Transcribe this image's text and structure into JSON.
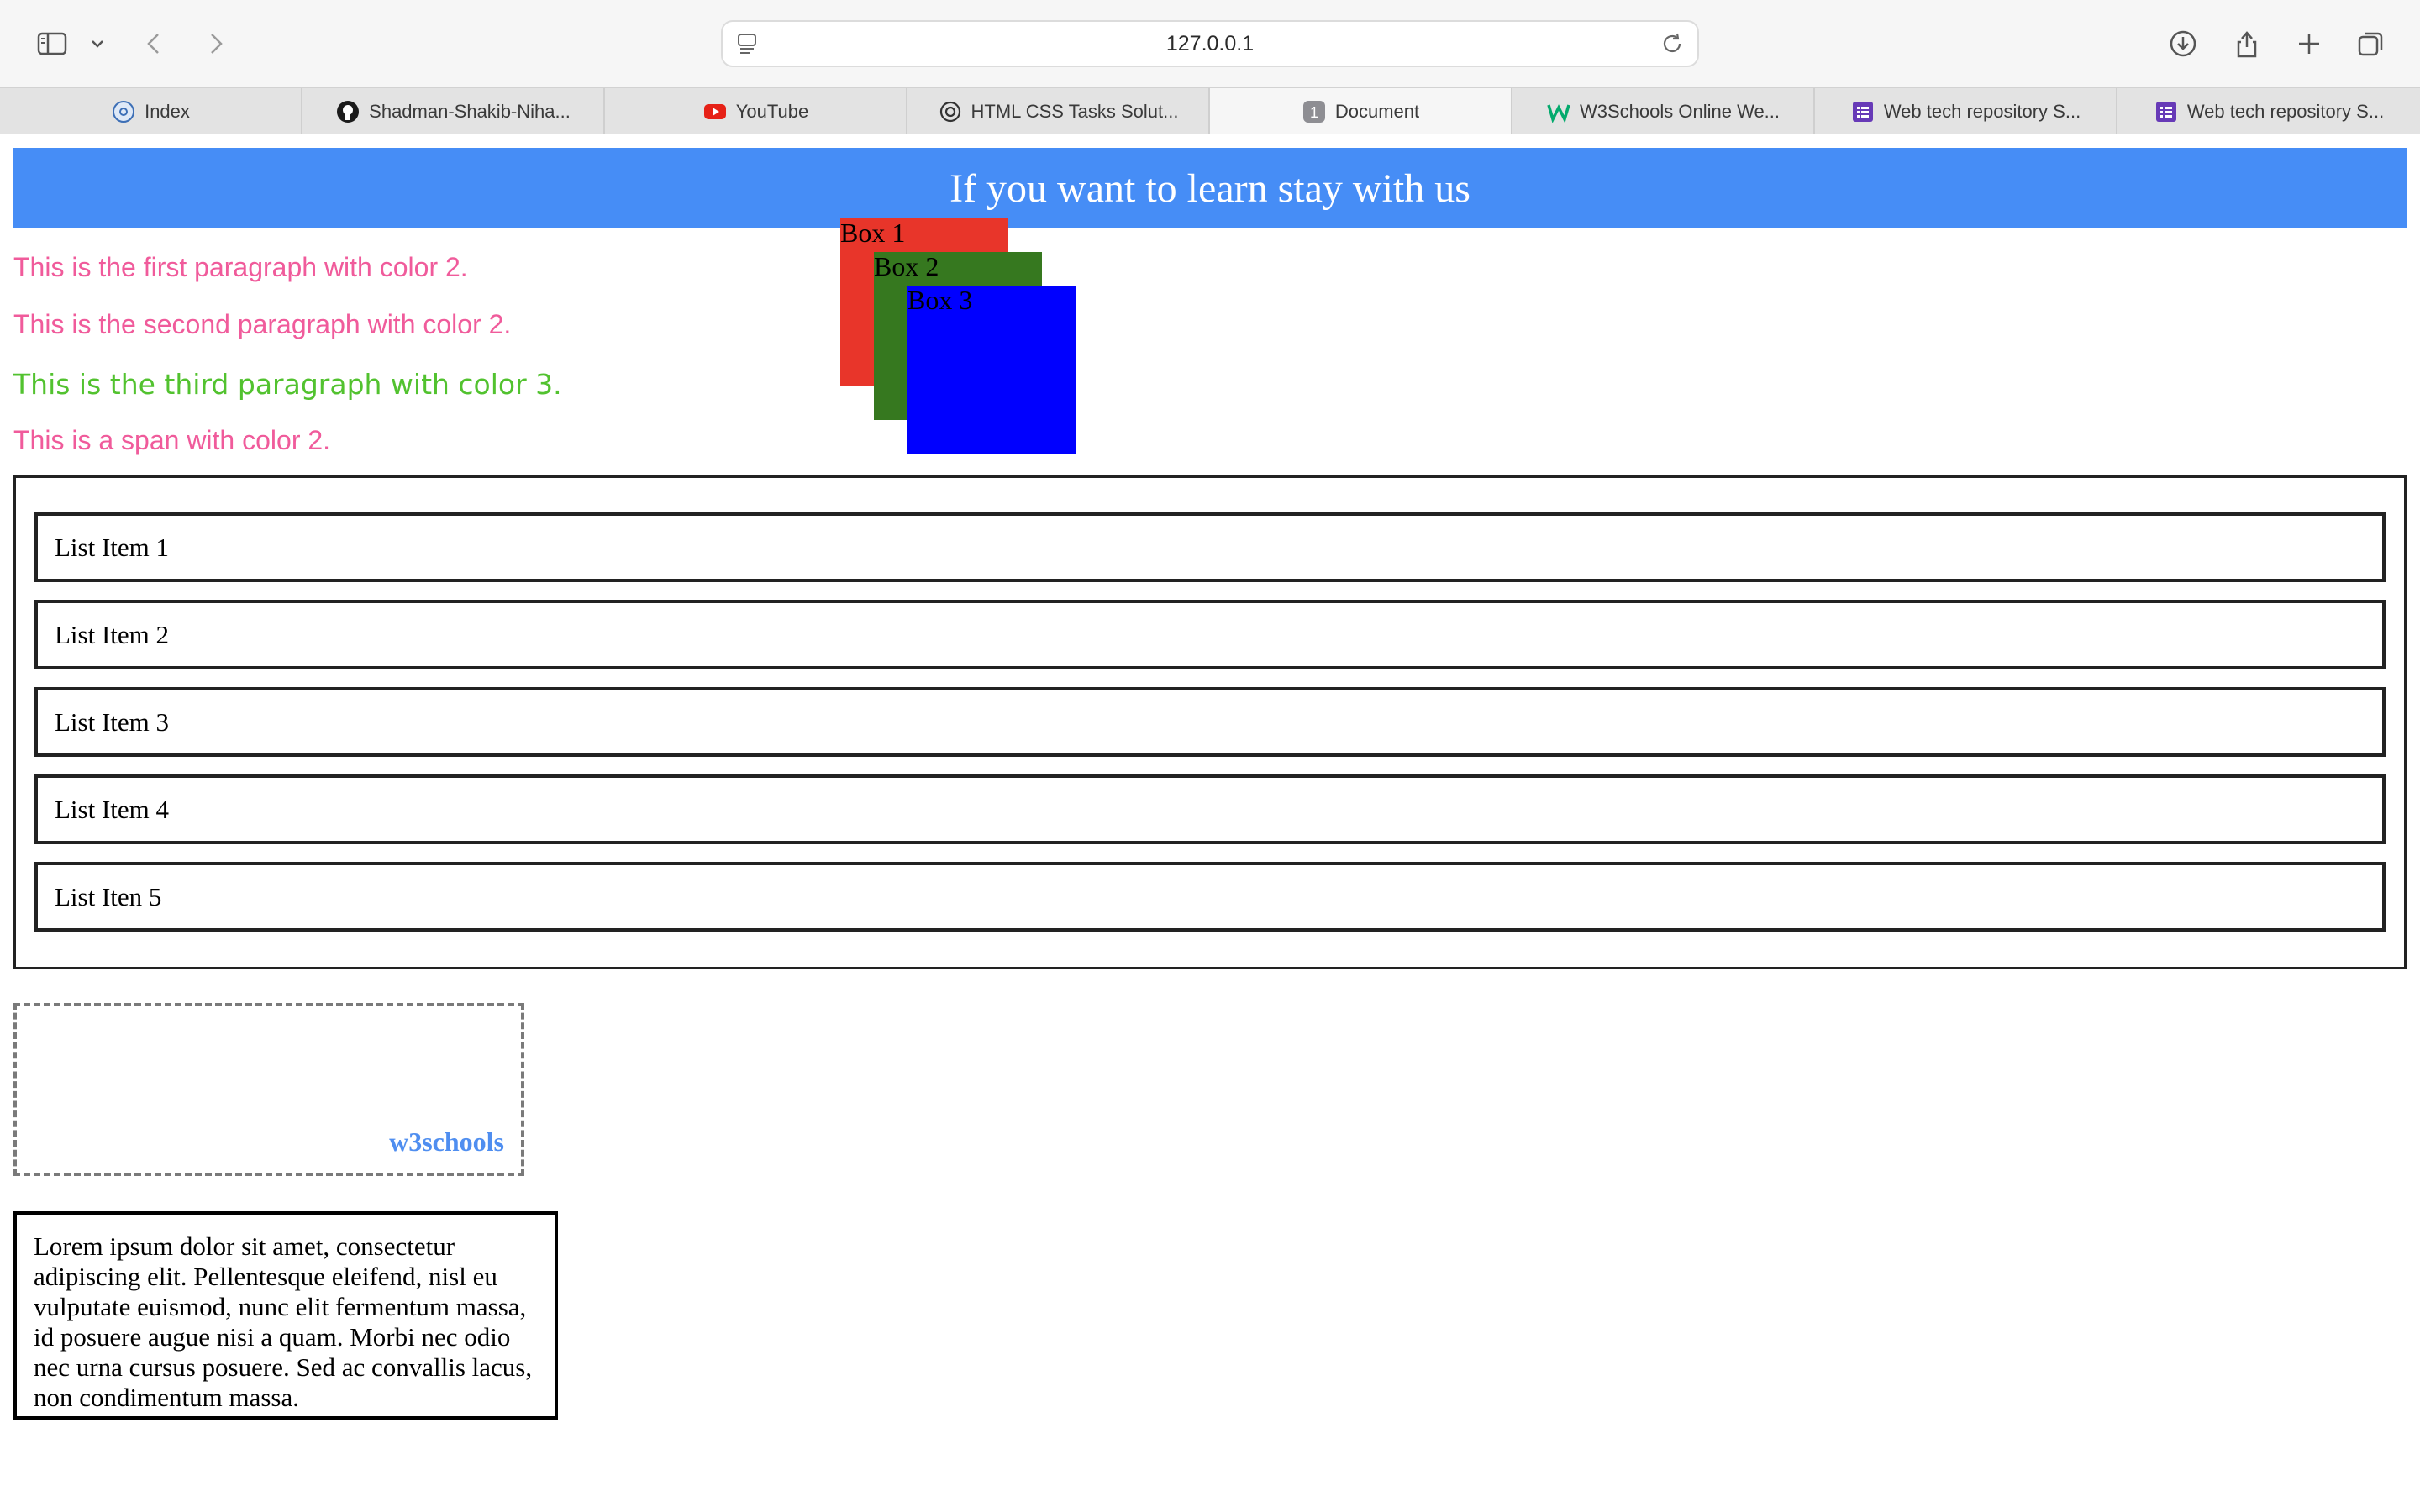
{
  "browser": {
    "url": "127.0.0.1",
    "tabs": [
      {
        "label": "Index",
        "icon": "globe-icon"
      },
      {
        "label": "Shadman-Shakib-Niha...",
        "icon": "github-icon"
      },
      {
        "label": "YouTube",
        "icon": "youtube-icon"
      },
      {
        "label": "HTML CSS Tasks Solut...",
        "icon": "openai-icon"
      },
      {
        "label": "Document",
        "icon": "number-one-icon",
        "badge": "1",
        "active": true
      },
      {
        "label": "W3Schools Online We...",
        "icon": "w3schools-icon"
      },
      {
        "label": "Web tech repository S...",
        "icon": "forms-icon"
      },
      {
        "label": "Web tech repository S...",
        "icon": "forms-icon"
      }
    ],
    "colors": {
      "youtube": "#e62117",
      "forms": "#673ab7",
      "w3": "#04aa6d"
    }
  },
  "page": {
    "banner": "If you want to learn stay with us",
    "paragraphs": [
      "This is the first paragraph with color 2.",
      "This is the second paragraph with color 2.",
      "This is the third paragraph with color 3.",
      "This is a span with color 2."
    ],
    "boxes": [
      {
        "label": "Box 1",
        "color": "#e8352a"
      },
      {
        "label": "Box 2",
        "color": "#36781f"
      },
      {
        "label": "Box 3",
        "color": "#0000ff"
      }
    ],
    "list_items": [
      "List Item 1",
      "List Item 2",
      "List Item 3",
      "List Item 4",
      "List Iten 5"
    ],
    "w3_text": "w3schools",
    "lorem": "Lorem ipsum dolor sit amet, consectetur adipiscing elit. Pellentesque eleifend, nisl eu vulputate euismod, nunc elit fermentum massa, id posuere augue nisi a quam. Morbi nec odio nec urna cursus posuere. Sed ac convallis lacus, non condimentum massa.",
    "colors": {
      "banner": "#468df6",
      "color2": "#f05b9b",
      "color3": "#52c22f"
    }
  }
}
